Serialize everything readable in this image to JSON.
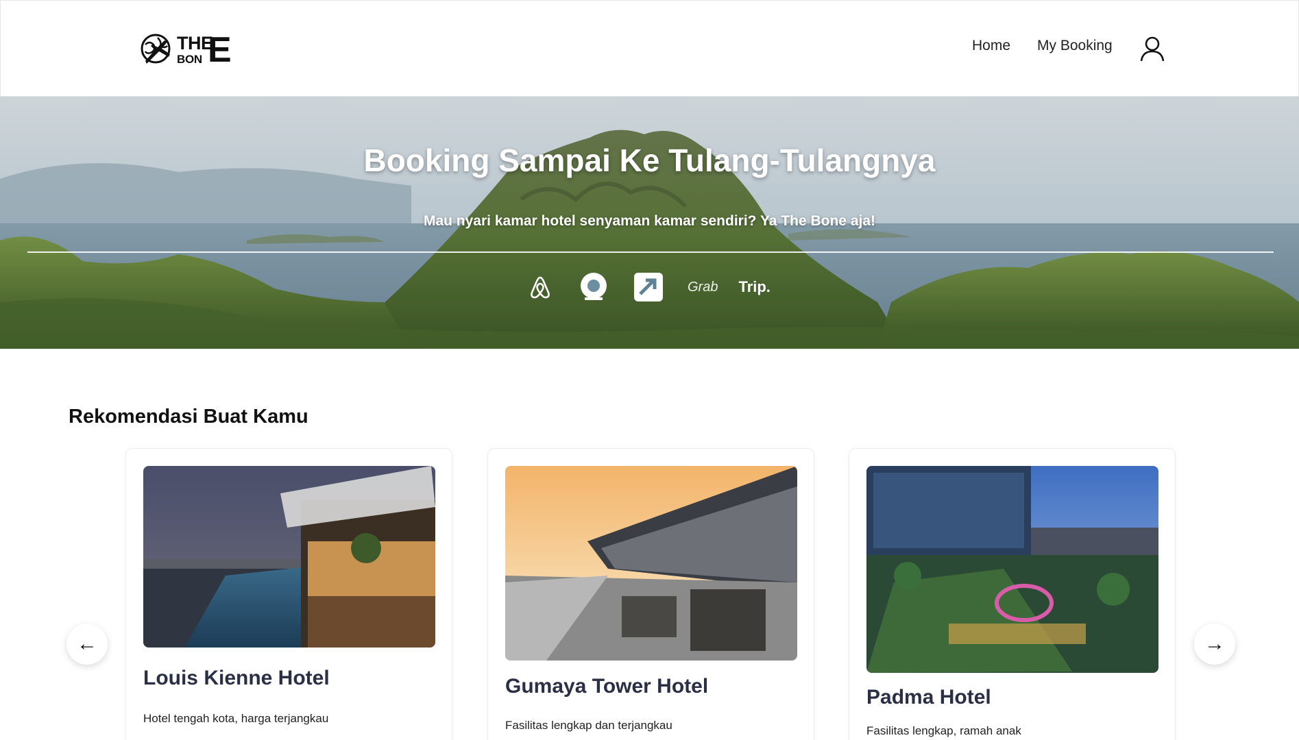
{
  "brand": {
    "line1": "THE",
    "line2": "BON",
    "big_letter": "E"
  },
  "nav": {
    "home": "Home",
    "my_booking": "My Booking"
  },
  "hero": {
    "title": "Booking Sampai Ke Tulang-Tulangnya",
    "subtitle": "Mau nyari kamar hotel senyaman kamar sendiri? Ya The Bone aja!",
    "partners": [
      "airbnb-icon",
      "agoda-icon",
      "traveloka-icon",
      "Grab",
      "Trip."
    ]
  },
  "recommendations": {
    "title": "Rekomendasi Buat Kamu",
    "cards": [
      {
        "name": "Louis Kienne Hotel",
        "desc": "Hotel tengah kota, harga terjangkau"
      },
      {
        "name": "Gumaya Tower Hotel",
        "desc": "Fasilitas lengkap dan terjangkau"
      },
      {
        "name": "Padma Hotel",
        "desc": "Fasilitas lengkap, ramah anak"
      }
    ],
    "prev_icon": "←",
    "next_icon": "→"
  }
}
